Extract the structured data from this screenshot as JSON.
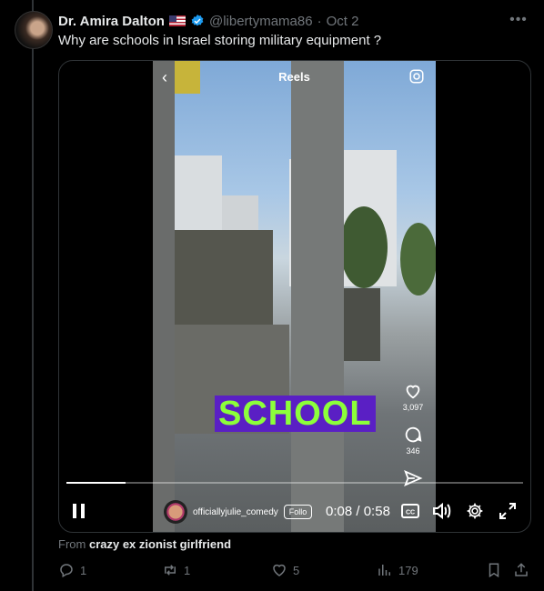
{
  "author": {
    "name": "Dr. Amira Dalton",
    "handle": "@libertymama86",
    "separator": "·",
    "date": "Oct 2"
  },
  "tweet": {
    "text": "Why are schools in Israel storing military equipment ?"
  },
  "video": {
    "overlay_title": "Reels",
    "caption_text": "SCHOOL",
    "likes": "3,097",
    "comments": "346",
    "creator_name": "officiallyjulie_comedy",
    "follow_label": "Follo",
    "time_current": "0:08",
    "time_separator": " / ",
    "time_total": "0:58",
    "progress_fraction": 0.13
  },
  "source": {
    "prefix": "From",
    "name": "crazy ex zionist girlfriend"
  },
  "actions": {
    "replies": "1",
    "reposts": "1",
    "likes": "5",
    "views": "179"
  },
  "colors": {
    "background": "#000000",
    "muted": "#71767b",
    "verified": "#1d9bf0",
    "caption_bg": "#5a1fc4",
    "caption_text": "#8cff3a"
  },
  "icons": [
    "verified-badge-icon",
    "more-icon",
    "back-chevron-icon",
    "camera-icon",
    "heart-icon",
    "comment-icon",
    "send-icon",
    "pause-icon",
    "closed-captions-icon",
    "volume-icon",
    "gear-icon",
    "fullscreen-icon",
    "reply-icon",
    "repost-icon",
    "like-icon",
    "views-icon",
    "bookmark-icon",
    "share-icon"
  ]
}
